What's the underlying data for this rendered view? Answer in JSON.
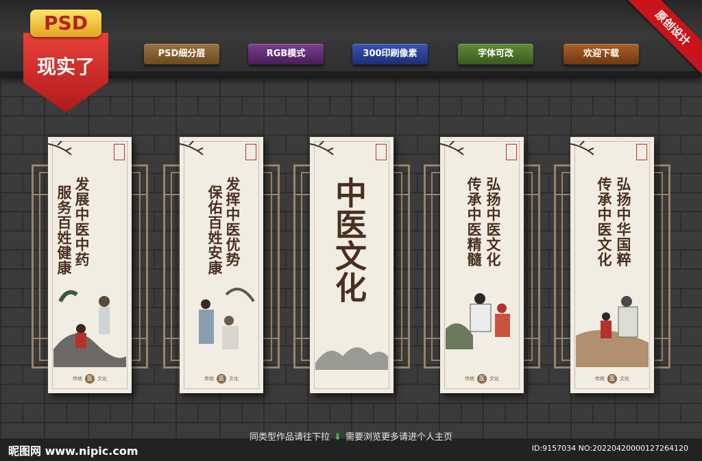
{
  "badge": {
    "top": "PSD",
    "main": "现实了"
  },
  "ribbon": "原创设计",
  "pills": [
    {
      "label": "PSD细分层",
      "color": "#7a5a2e"
    },
    {
      "label": "RGB模式",
      "color": "#5a2e6a"
    },
    {
      "label": "300印刷像素",
      "color": "#2c3f8a"
    },
    {
      "label": "字体可改",
      "color": "#4a6a2a"
    },
    {
      "label": "欢迎下载",
      "color": "#8a4a1e"
    }
  ],
  "panels": [
    {
      "col1": "发展中医中药",
      "col2": "服务百姓健康"
    },
    {
      "col1": "发挥中医优势",
      "col2": "保佑百姓安康"
    },
    {
      "title": "中医文化"
    },
    {
      "col1": "弘扬中医文化",
      "col2": "传承中医精髓"
    },
    {
      "col1": "弘扬中华国粹",
      "col2": "传承中医文化"
    }
  ],
  "footer_left": "传统",
  "footer_right": "文化",
  "footer_mark": "医",
  "hint_left": "同类型作品请往下拉",
  "hint_right": "需要浏览更多请进个人主页",
  "logo": "昵图网 www.nipic.com",
  "id_text": "ID:9157034 NO:20220420000127264120"
}
